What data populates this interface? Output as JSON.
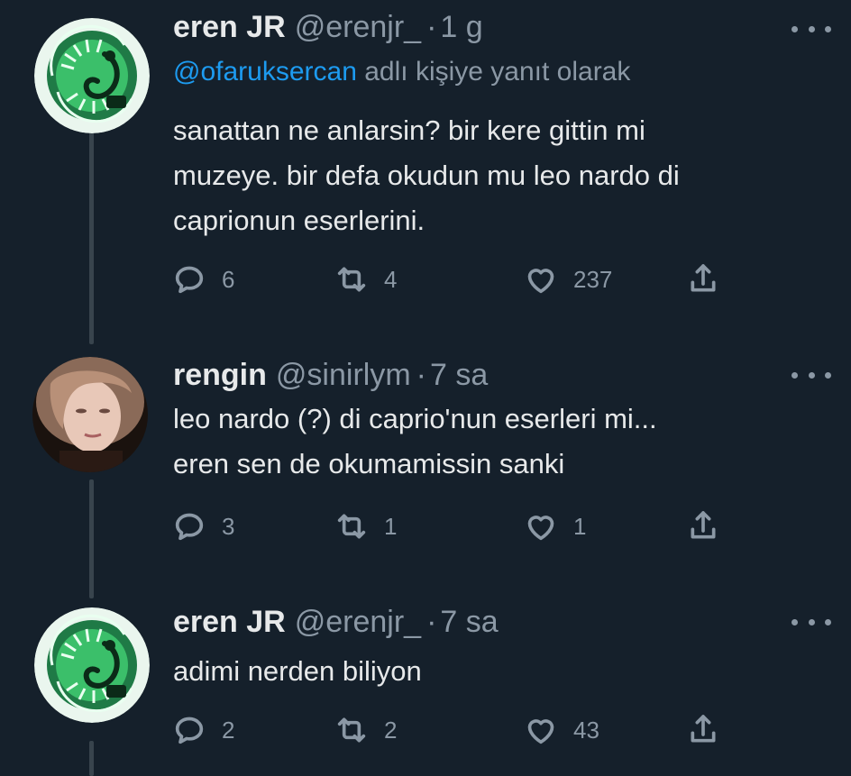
{
  "tweets": [
    {
      "name": "eren JR",
      "handle": "@erenjr_",
      "time": "1 g",
      "reply_to_mention": "@ofaruksercan",
      "reply_to_suffix": "adlı kişiye yanıt olarak",
      "text": "sanattan ne anlarsin? bir kere gittin mi\nmuzeye. bir defa okudun mu leo nardo di\ncaprionun eserlerini.",
      "replies": "6",
      "retweets": "4",
      "likes": "237",
      "avatar_icon": "green-serpent-logo"
    },
    {
      "name": "rengin",
      "handle": "@sinirlym",
      "time": "7 sa",
      "text": "leo nardo (?) di caprio'nun eserleri mi...\neren sen de okumamissin sanki",
      "replies": "3",
      "retweets": "1",
      "likes": "1",
      "avatar_icon": "profile-photo"
    },
    {
      "name": "eren JR",
      "handle": "@erenjr_",
      "time": "7 sa",
      "text": "adimi nerden biliyon",
      "replies": "2",
      "retweets": "2",
      "likes": "43",
      "avatar_icon": "green-serpent-logo"
    }
  ],
  "colors": {
    "background": "#15202b",
    "text": "#e7e9ea",
    "secondary": "#8b98a5",
    "link": "#1d9bf0",
    "avatar_green": "#3bbf6a"
  }
}
